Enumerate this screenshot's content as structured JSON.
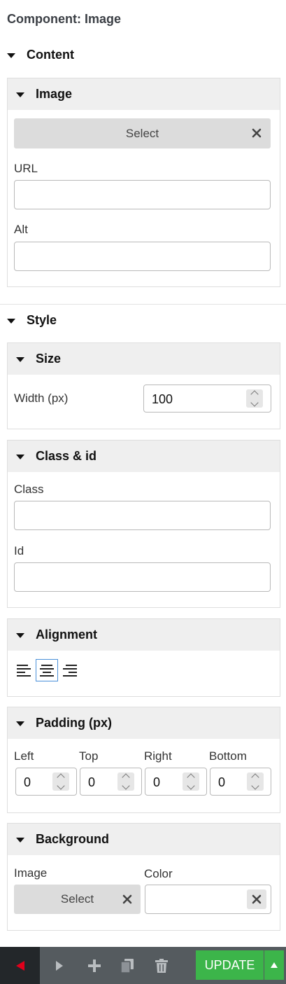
{
  "component_title": "Component: Image",
  "content": {
    "heading": "Content",
    "image_panel": {
      "heading": "Image",
      "select_label": "Select",
      "url_label": "URL",
      "url_value": "",
      "alt_label": "Alt",
      "alt_value": ""
    }
  },
  "style": {
    "heading": "Style",
    "size": {
      "heading": "Size",
      "width_label": "Width (px)",
      "width_value": "100"
    },
    "class_id": {
      "heading": "Class & id",
      "class_label": "Class",
      "class_value": "",
      "id_label": "Id",
      "id_value": ""
    },
    "alignment": {
      "heading": "Alignment",
      "options": [
        "left",
        "center",
        "right"
      ],
      "selected": "center"
    },
    "padding": {
      "heading": "Padding (px)",
      "left_label": "Left",
      "left_value": "0",
      "top_label": "Top",
      "top_value": "0",
      "right_label": "Right",
      "right_value": "0",
      "bottom_label": "Bottom",
      "bottom_value": "0"
    },
    "background": {
      "heading": "Background",
      "image_label": "Image",
      "select_label": "Select",
      "color_label": "Color",
      "color_value": ""
    }
  },
  "footer": {
    "update_label": "UPDATE"
  },
  "colors": {
    "accent_green": "#3cb54a",
    "footer_bg": "#555b5f",
    "back_arrow": "#e0001b",
    "active_border": "#4a90d9"
  }
}
